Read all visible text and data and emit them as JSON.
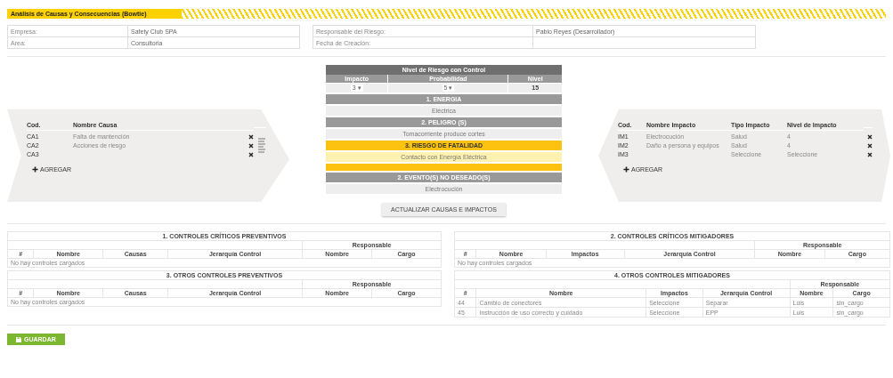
{
  "header": {
    "title": "Análisis de Causas y Consecuencias (Bowtie)"
  },
  "info_left": [
    {
      "label": "Empresa:",
      "value": "Safety Club SPA"
    },
    {
      "label": "Area:",
      "value": "Consultoria"
    }
  ],
  "info_right": [
    {
      "label": "Responsable del Riesgo:",
      "value": "Pablo Reyes (Desarrollador)"
    },
    {
      "label": "Fecha de Creación:"
    }
  ],
  "causes": {
    "columns": [
      "Cod.",
      "Nombre Causa"
    ],
    "rows": [
      {
        "code": "CA1",
        "name": "Falta de mantención"
      },
      {
        "code": "CA2",
        "name": "Acciones de riesgo"
      },
      {
        "code": "CA3"
      }
    ],
    "add": "AGREGAR"
  },
  "risk": {
    "title": "Nivel de Riesgo con Control",
    "columns": [
      "Impacto",
      "Probabilidad",
      "Nivel"
    ],
    "impact": "3",
    "probability": "5",
    "select_caret": "▾",
    "level_value": "15",
    "sections": [
      {
        "title": "1. ENERGIA",
        "value": "Eléctrica",
        "highlight": false
      },
      {
        "title": "2. PELIGRO (S)",
        "value": "Tomacorriente produce cortes",
        "highlight": false
      },
      {
        "title": "3. RIESGO DE FATALIDAD",
        "value": "Contacto con Energía Eléctrica",
        "highlight": true
      },
      {
        "title": "2. EVENTO(S) NO DESEADO(S)",
        "value": "Electrocución",
        "highlight": false
      }
    ]
  },
  "impacts": {
    "columns": [
      "Cod.",
      "Nombre Impacto",
      "Tipo Impacto",
      "Nivel de Impacto"
    ],
    "rows": [
      {
        "code": "IM1",
        "name": "Electrocución",
        "type": "Salud",
        "level": "4"
      },
      {
        "code": "IM2",
        "name": "Daño a persona y equipos",
        "type": "Salud",
        "level": "4"
      },
      {
        "code": "IM3",
        "type": "Seleccione",
        "level": "Seleccione"
      }
    ],
    "add": "AGREGAR"
  },
  "update_button": "ACTUALIZAR CAUSAS E IMPACTOS",
  "tables": [
    {
      "title": "1. CONTROLES CRÍTICOS PREVENTIVOS",
      "responsable": "Responsable",
      "columns": [
        "#",
        "Nombre",
        "Causas",
        "Jerarquía Control",
        "Nombre",
        "Cargo"
      ],
      "empty": "No hay controles cargados"
    },
    {
      "title": "2. CONTROLES CRÍTICOS MITIGADORES",
      "responsable": "Responsable",
      "columns": [
        "#",
        "Nombre",
        "Impactos",
        "Jerarquía Control",
        "Nombre",
        "Cargo"
      ],
      "empty": "No hay controles cargados"
    },
    {
      "title": "3. OTROS CONTROLES PREVENTIVOS",
      "responsable": "Responsable",
      "columns": [
        "#",
        "Nombre",
        "Causas",
        "Jerarquía Control",
        "Nombre",
        "Cargo"
      ],
      "empty": "No hay controles cargados"
    },
    {
      "title": "4. OTROS CONTROLES MITIGADORES",
      "responsable": "Responsable",
      "columns": [
        "#",
        "Nombre",
        "Impactos",
        "Jerarquía Control",
        "Nombre",
        "Cargo"
      ],
      "rows": [
        [
          "44",
          "Cambio de conectores",
          "Seleccione",
          "Separar",
          "Luis",
          "sin_cargo"
        ],
        [
          "45",
          "Instrucción de uso correcto y cuidado",
          "Seleccione",
          "EPP",
          "Luis",
          "sin_cargo"
        ]
      ]
    }
  ],
  "save_button": "GUARDAR"
}
